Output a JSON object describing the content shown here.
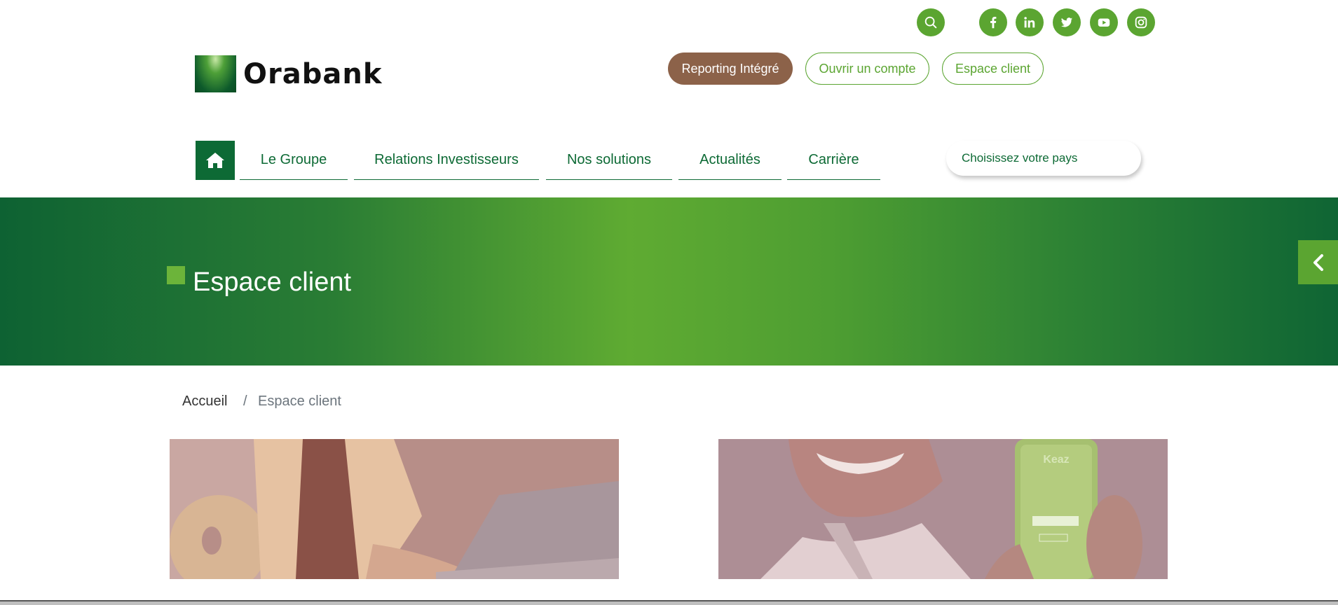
{
  "social": {
    "icons": [
      "search-icon",
      "facebook-icon",
      "linkedin-icon",
      "twitter-icon",
      "youtube-icon",
      "instagram-icon"
    ],
    "color": "#5ba531"
  },
  "logo": {
    "text": "Orabank"
  },
  "header_buttons": {
    "reporting": "Reporting Intégré",
    "open_account": "Ouvrir un compte",
    "client_space": "Espace client"
  },
  "nav": {
    "home_icon": "home-icon",
    "items": [
      "Le Groupe",
      "Relations Investisseurs",
      "Nos solutions",
      "Actualités",
      "Carrière"
    ],
    "country_select": "Choisissez votre pays"
  },
  "hero": {
    "title": "Espace client",
    "side_tab_icon": "chevron-left-icon"
  },
  "breadcrumb": {
    "home": "Accueil",
    "separator": "/",
    "current": "Espace client"
  },
  "cards": {
    "card1_image": "woman-laptop-image",
    "card2_image": "man-phone-image",
    "phone_screen_text": "Keaz"
  },
  "colors": {
    "brand_green": "#0d6a35",
    "accent_green": "#5ba531",
    "brown": "#8c6249"
  }
}
